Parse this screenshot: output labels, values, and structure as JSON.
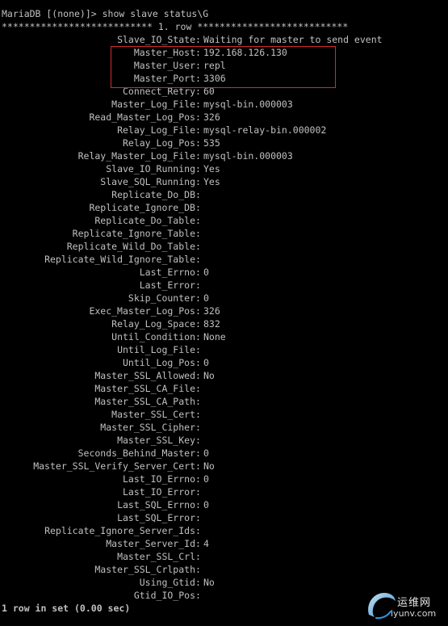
{
  "terminal": {
    "prompt_line": "MariaDB [(none)]> show slave status\\G",
    "row_header": "*************************** 1. row ***************************",
    "fields": [
      {
        "key": "Slave_IO_State",
        "value": "Waiting for master to send event"
      },
      {
        "key": "Master_Host",
        "value": "192.168.126.130"
      },
      {
        "key": "Master_User",
        "value": "repl"
      },
      {
        "key": "Master_Port",
        "value": "3306"
      },
      {
        "key": "Connect_Retry",
        "value": "60"
      },
      {
        "key": "Master_Log_File",
        "value": "mysql-bin.000003"
      },
      {
        "key": "Read_Master_Log_Pos",
        "value": "326"
      },
      {
        "key": "Relay_Log_File",
        "value": "mysql-relay-bin.000002"
      },
      {
        "key": "Relay_Log_Pos",
        "value": "535"
      },
      {
        "key": "Relay_Master_Log_File",
        "value": "mysql-bin.000003"
      },
      {
        "key": "Slave_IO_Running",
        "value": "Yes"
      },
      {
        "key": "Slave_SQL_Running",
        "value": "Yes"
      },
      {
        "key": "Replicate_Do_DB",
        "value": ""
      },
      {
        "key": "Replicate_Ignore_DB",
        "value": ""
      },
      {
        "key": "Replicate_Do_Table",
        "value": ""
      },
      {
        "key": "Replicate_Ignore_Table",
        "value": ""
      },
      {
        "key": "Replicate_Wild_Do_Table",
        "value": ""
      },
      {
        "key": "Replicate_Wild_Ignore_Table",
        "value": ""
      },
      {
        "key": "Last_Errno",
        "value": "0"
      },
      {
        "key": "Last_Error",
        "value": ""
      },
      {
        "key": "Skip_Counter",
        "value": "0"
      },
      {
        "key": "Exec_Master_Log_Pos",
        "value": "326"
      },
      {
        "key": "Relay_Log_Space",
        "value": "832"
      },
      {
        "key": "Until_Condition",
        "value": "None"
      },
      {
        "key": "Until_Log_File",
        "value": ""
      },
      {
        "key": "Until_Log_Pos",
        "value": "0"
      },
      {
        "key": "Master_SSL_Allowed",
        "value": "No"
      },
      {
        "key": "Master_SSL_CA_File",
        "value": ""
      },
      {
        "key": "Master_SSL_CA_Path",
        "value": ""
      },
      {
        "key": "Master_SSL_Cert",
        "value": ""
      },
      {
        "key": "Master_SSL_Cipher",
        "value": ""
      },
      {
        "key": "Master_SSL_Key",
        "value": ""
      },
      {
        "key": "Seconds_Behind_Master",
        "value": "0"
      },
      {
        "key": "Master_SSL_Verify_Server_Cert",
        "value": "No"
      },
      {
        "key": "Last_IO_Errno",
        "value": "0"
      },
      {
        "key": "Last_IO_Error",
        "value": ""
      },
      {
        "key": "Last_SQL_Errno",
        "value": "0"
      },
      {
        "key": "Last_SQL_Error",
        "value": ""
      },
      {
        "key": "Replicate_Ignore_Server_Ids",
        "value": ""
      },
      {
        "key": "Master_Server_Id",
        "value": "4"
      },
      {
        "key": "Master_SSL_Crl",
        "value": ""
      },
      {
        "key": "Master_SSL_Crlpath",
        "value": ""
      },
      {
        "key": "Using_Gtid",
        "value": "No"
      },
      {
        "key": "Gtid_IO_Pos",
        "value": ""
      }
    ],
    "summary_line": "1 row in set (0.00 sec)"
  },
  "watermark": {
    "name": "运维网",
    "domain": "iyunv.com"
  },
  "colors": {
    "background": "#000000",
    "text": "#c0c0c0",
    "highlight_box": "#d22b2b",
    "watermark_accent": "#2f8fd8"
  }
}
